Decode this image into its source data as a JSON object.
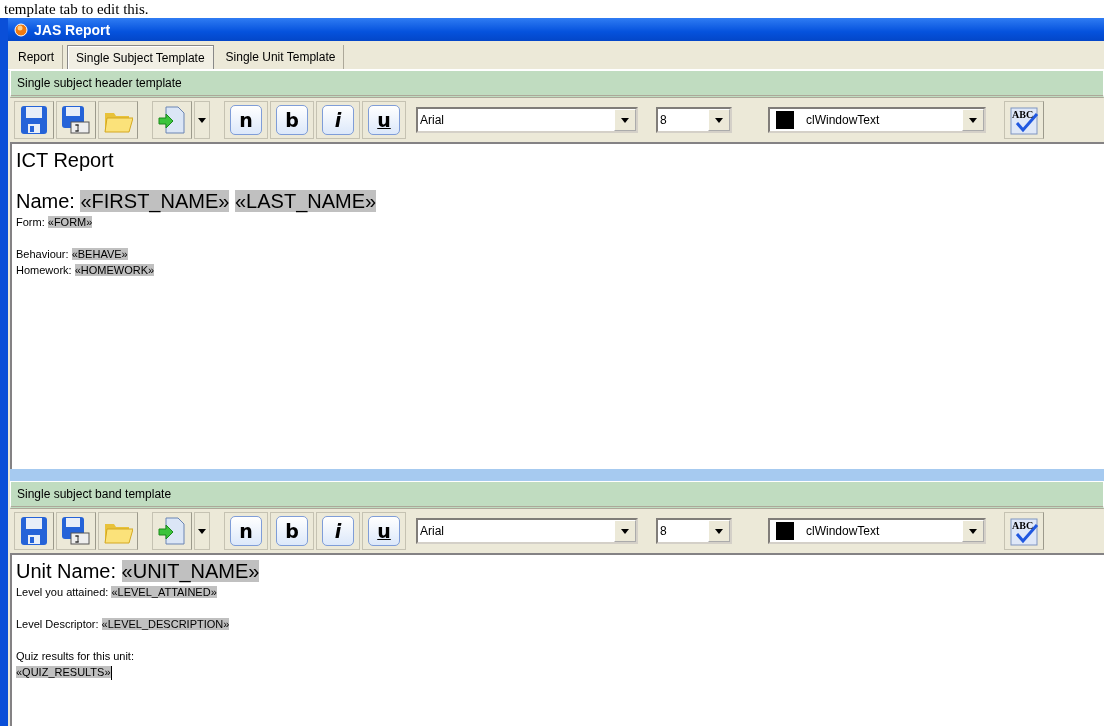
{
  "caption": "template tab to edit this.",
  "window": {
    "title": "JAS Report"
  },
  "tabs": [
    {
      "label": "Report",
      "selected": false
    },
    {
      "label": "Single Subject Template",
      "selected": true
    },
    {
      "label": "Single Unit Template",
      "selected": false
    }
  ],
  "panels": [
    {
      "title": "Single subject header template",
      "toolbar": {
        "style_buttons": [
          "n",
          "b",
          "i",
          "u"
        ],
        "font": "Arial",
        "size": "8",
        "color_name": "clWindowText",
        "spell_label": "ABC"
      },
      "lines": [
        {
          "kind": "large",
          "gap_before": false,
          "caret": false,
          "parts": [
            {
              "text": "ICT Report",
              "field": false
            }
          ]
        },
        {
          "kind": "large",
          "gap_before": true,
          "caret": false,
          "parts": [
            {
              "text": "Name: ",
              "field": false
            },
            {
              "text": "«FIRST_NAME»",
              "field": true
            },
            {
              "text": "«LAST_NAME»",
              "field": true
            }
          ]
        },
        {
          "kind": "small",
          "gap_before": false,
          "caret": false,
          "parts": [
            {
              "text": "Form: ",
              "field": false
            },
            {
              "text": "«FORM»",
              "field": true
            }
          ]
        },
        {
          "kind": "small",
          "gap_before": true,
          "caret": false,
          "parts": [
            {
              "text": "Behaviour: ",
              "field": false
            },
            {
              "text": "«BEHAVE»",
              "field": true
            }
          ]
        },
        {
          "kind": "small",
          "gap_before": false,
          "caret": false,
          "parts": [
            {
              "text": "Homework: ",
              "field": false
            },
            {
              "text": "«HOMEWORK»",
              "field": true
            }
          ]
        }
      ]
    },
    {
      "title": "Single subject band template",
      "toolbar": {
        "style_buttons": [
          "n",
          "b",
          "i",
          "u"
        ],
        "font": "Arial",
        "size": "8",
        "color_name": "clWindowText",
        "spell_label": "ABC"
      },
      "lines": [
        {
          "kind": "large",
          "gap_before": false,
          "caret": false,
          "parts": [
            {
              "text": "Unit Name: ",
              "field": false
            },
            {
              "text": "«UNIT_NAME»",
              "field": true
            }
          ]
        },
        {
          "kind": "small",
          "gap_before": false,
          "caret": false,
          "parts": [
            {
              "text": "Level you attained: ",
              "field": false
            },
            {
              "text": "«LEVEL_ATTAINED»",
              "field": true
            }
          ]
        },
        {
          "kind": "small",
          "gap_before": true,
          "caret": false,
          "parts": [
            {
              "text": "Level Descriptor: ",
              "field": false
            },
            {
              "text": "«LEVEL_DESCRIPTION»",
              "field": true
            }
          ]
        },
        {
          "kind": "small",
          "gap_before": true,
          "caret": false,
          "parts": [
            {
              "text": "Quiz results for this unit:",
              "field": false
            }
          ]
        },
        {
          "kind": "small",
          "gap_before": false,
          "caret": true,
          "parts": [
            {
              "text": "«QUIZ_RESULTS»",
              "field": true
            }
          ]
        }
      ]
    }
  ]
}
